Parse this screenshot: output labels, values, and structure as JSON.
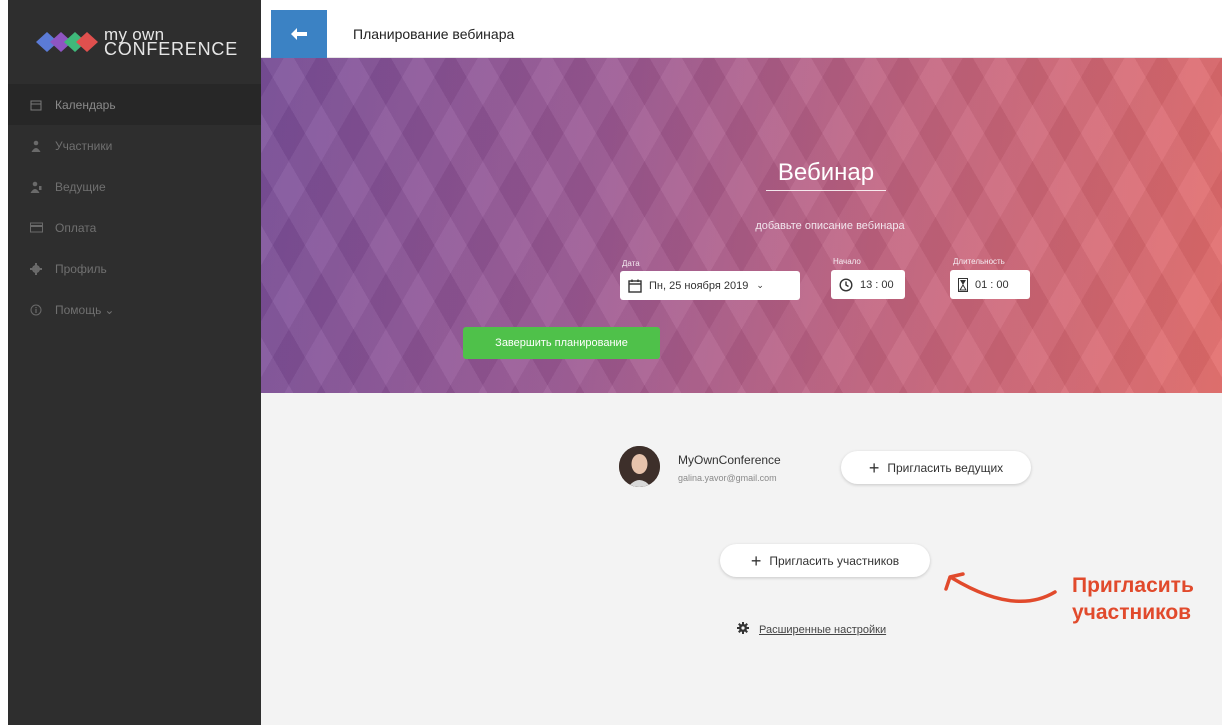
{
  "app": {
    "logo_line1": "my own",
    "logo_line2": "CONFERENCE"
  },
  "sidebar": {
    "items": [
      {
        "label": "Календарь",
        "icon": "calendar-icon",
        "active": true
      },
      {
        "label": "Участники",
        "icon": "participants-icon"
      },
      {
        "label": "Ведущие",
        "icon": "hosts-icon"
      },
      {
        "label": "Оплата",
        "icon": "card-icon"
      },
      {
        "label": "Профиль",
        "icon": "gear-icon"
      },
      {
        "label": "Помощь",
        "icon": "info-icon",
        "suffix": "⌄"
      }
    ]
  },
  "header": {
    "back_icon": "arrow-left-icon",
    "title": "Планирование вебинара"
  },
  "webinar": {
    "title": "Вебинар",
    "description_placeholder": "добавьте описание вебинара",
    "date_label": "Дата",
    "date_value": "Пн, 25 ноября 2019",
    "start_label": "Начало",
    "start_value": "13 : 00",
    "duration_label": "Длительность",
    "duration_value": "01 : 00"
  },
  "host": {
    "name": "MyOwnConference",
    "email": "galina.yavor@gmail.com"
  },
  "actions": {
    "invite_hosts": "Пригласить ведущих",
    "invite_participants": "Пригласить участников",
    "advanced_settings": "Расширенные настройки",
    "finish_planning": "Завершить планирование"
  },
  "annotation": {
    "line1": "Пригласить",
    "line2": "участников"
  },
  "colors": {
    "sidebar_bg": "#2e2e2e",
    "accent_blue": "#3b82c4",
    "finish_green": "#4fc14a",
    "annotation_red": "#e14a2c"
  }
}
